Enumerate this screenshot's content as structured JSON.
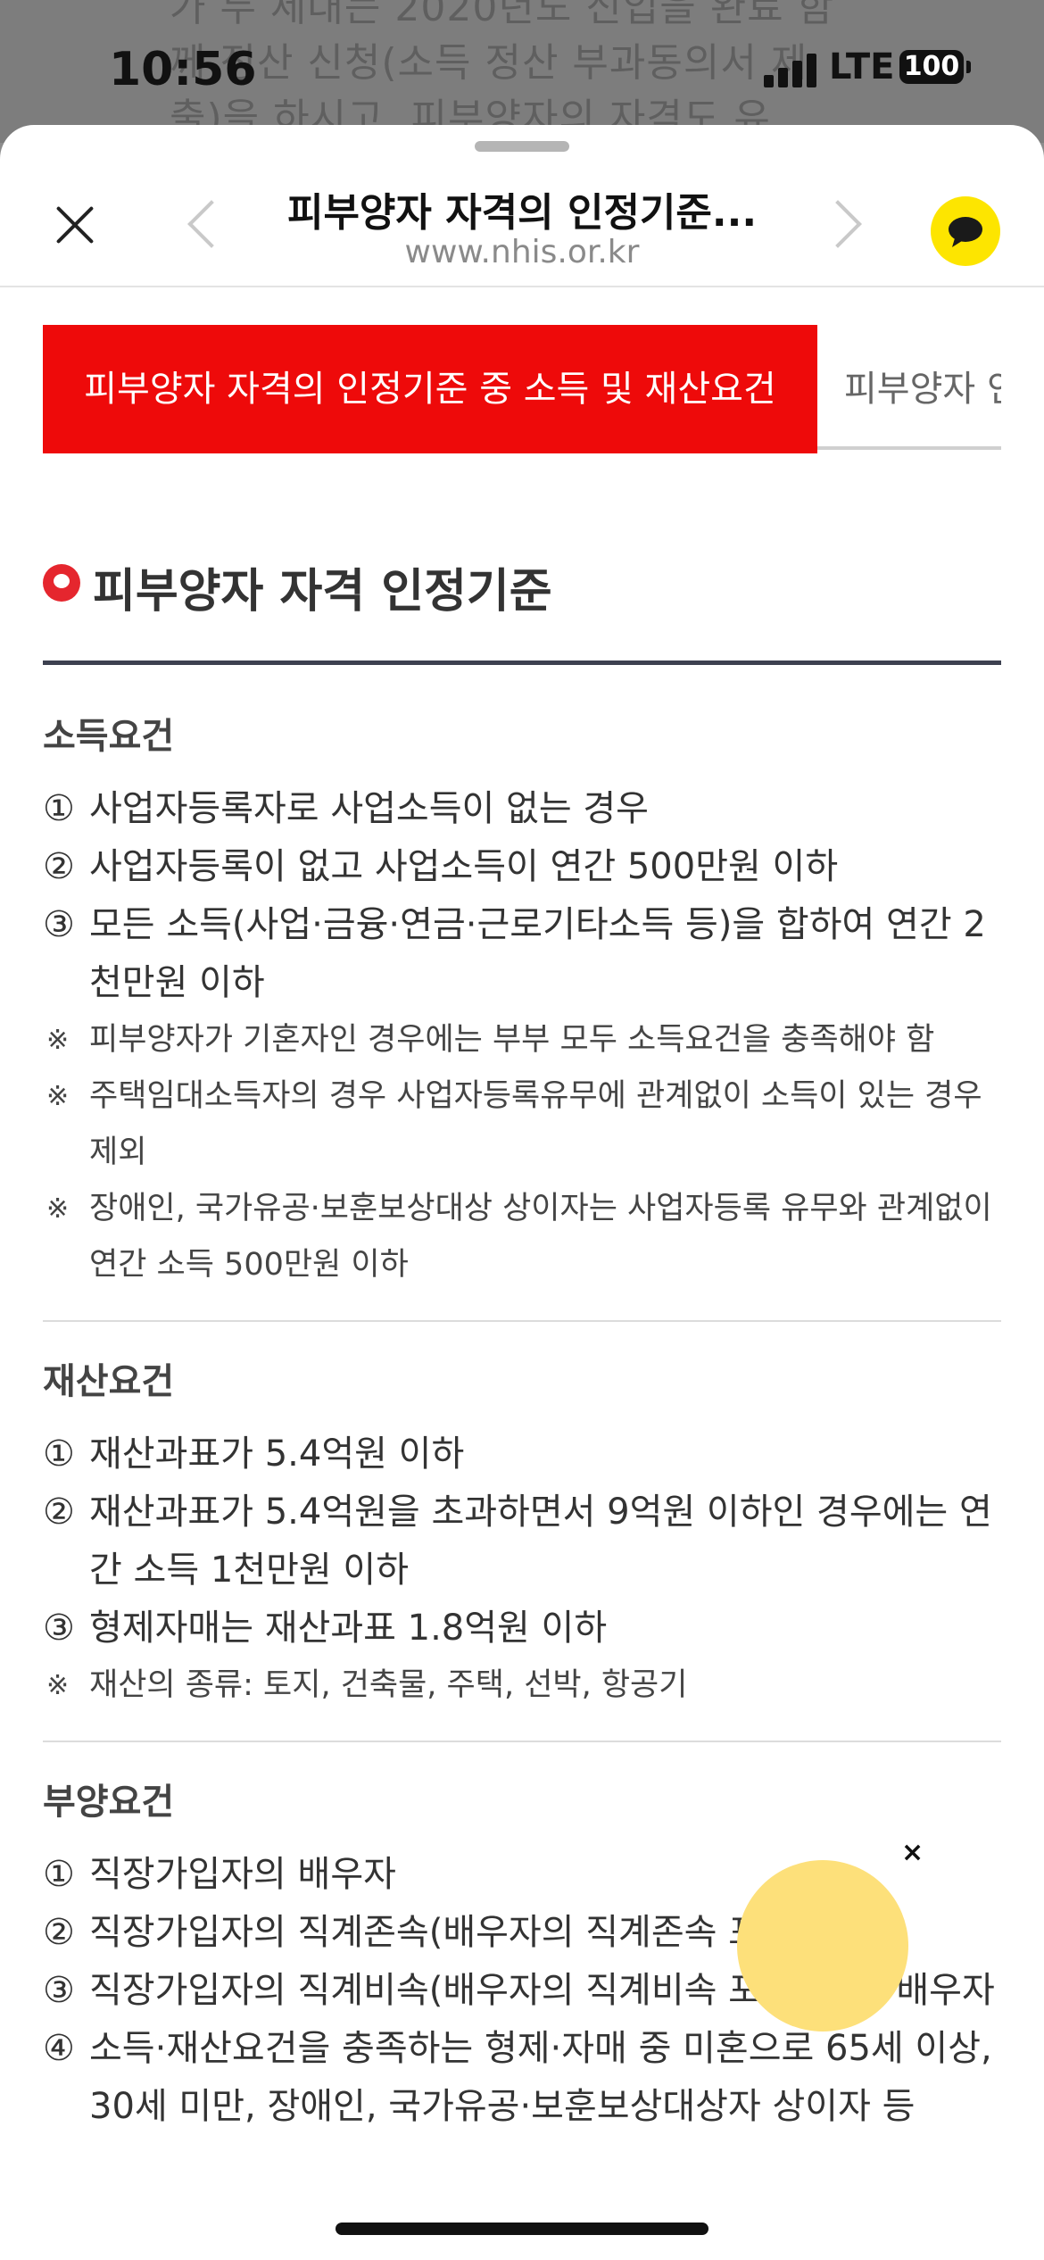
{
  "background_page": {
    "text": "가 두 세대는 2020년도 신입을 완료 함께 정산 신청(소득 정산 부과동의서 제출)을 하시고, 피부양자의 자격도 유"
  },
  "status_bar": {
    "time": "10:56",
    "network": "LTE",
    "battery": "100"
  },
  "nav": {
    "title": "피부양자 자격의 인정기준...",
    "url": "www.nhis.or.kr",
    "close_icon": "close-icon",
    "back_icon": "chevron-left-icon",
    "forward_icon": "chevron-right-icon",
    "talk_icon": "kakaotalk-bubble-icon",
    "talk_color": "#fde500"
  },
  "tabs": [
    {
      "label": "피부양자 자격의 인정기준 중 소득 및 재산요건",
      "active": true,
      "color": "#ee0a0a"
    },
    {
      "label": "피부양자 인",
      "active": false
    }
  ],
  "section": {
    "title": "피부양자 자격 인정기준"
  },
  "blocks": [
    {
      "title": "소득요건",
      "items": [
        {
          "num": "①",
          "text": "사업자등록자로 사업소득이 없는 경우"
        },
        {
          "num": "②",
          "text": "사업자등록이 없고 사업소득이 연간 500만원 이하"
        },
        {
          "num": "③",
          "text": "모든 소득(사업·금융·연금·근로기타소득 등)을 합하여 연간 2천만원 이하"
        }
      ],
      "notes": [
        {
          "mark": "※",
          "text": "피부양자가 기혼자인 경우에는 부부 모두 소득요건을 충족해야 함"
        },
        {
          "mark": "※",
          "text": "주택임대소득자의 경우 사업자등록유무에 관계없이 소득이 있는 경우 제외"
        },
        {
          "mark": "※",
          "text": "장애인, 국가유공·보훈보상대상 상이자는 사업자등록 유무와 관계없이 연간 소득 500만원 이하"
        }
      ]
    },
    {
      "title": "재산요건",
      "items": [
        {
          "num": "①",
          "text": "재산과표가 5.4억원 이하"
        },
        {
          "num": "②",
          "text": "재산과표가 5.4억원을 초과하면서 9억원 이하인 경우에는 연간 소득 1천만원 이하"
        },
        {
          "num": "③",
          "text": "형제자매는 재산과표 1.8억원 이하"
        }
      ],
      "notes": [
        {
          "mark": "※",
          "text": "재산의 종류: 토지, 건축물, 주택, 선박, 항공기"
        }
      ]
    },
    {
      "title": "부양요건",
      "items": [
        {
          "num": "①",
          "text": "직장가입자의 배우자"
        },
        {
          "num": "②",
          "text": "직장가입자의 직계존속(배우자의 직계존속 포함)"
        },
        {
          "num": "③",
          "text": "직장가입자의 직계비속(배우자의 직계비속 포함)과 그 배우자"
        },
        {
          "num": "④",
          "text": "소득·재산요건을 충족하는 형제·자매 중 미혼으로 65세 이상, 30세 미만, 장애인, 국가유공·보훈보상대상자 상이자 등"
        }
      ],
      "notes": []
    }
  ],
  "floating_bubble": {
    "close_label": "×",
    "color": "#fde07a"
  }
}
